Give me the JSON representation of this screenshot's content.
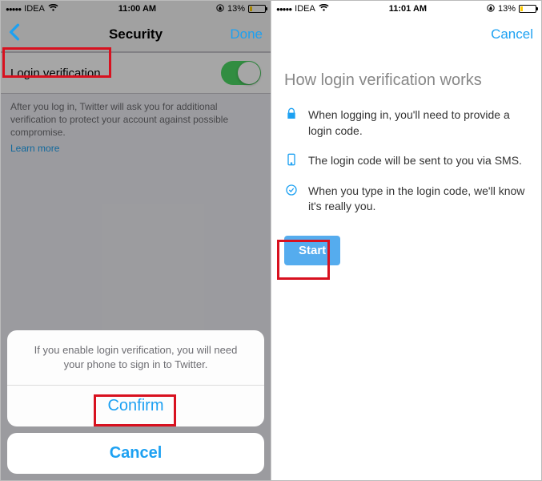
{
  "status": {
    "carrier": "IDEA",
    "time": "11:00 AM",
    "battery_pct": "13%",
    "time_right": "11:01 AM"
  },
  "left": {
    "back": "",
    "title": "Security",
    "done": "Done",
    "row_label": "Login verification",
    "footer": "After you log in, Twitter will ask you for additional verification to protect your account against possible compromise.",
    "learn_more": "Learn more",
    "sheet_msg": "If you enable login verification, you will need your phone to sign in to Twitter.",
    "confirm": "Confirm",
    "cancel": "Cancel"
  },
  "right": {
    "cancel": "Cancel",
    "title": "How login verification works",
    "bullets": [
      "When logging in, you'll need to provide a login code.",
      "The login code will be sent to you via SMS.",
      "When you type in the login code, we'll know it's really you."
    ],
    "start": "Start"
  }
}
